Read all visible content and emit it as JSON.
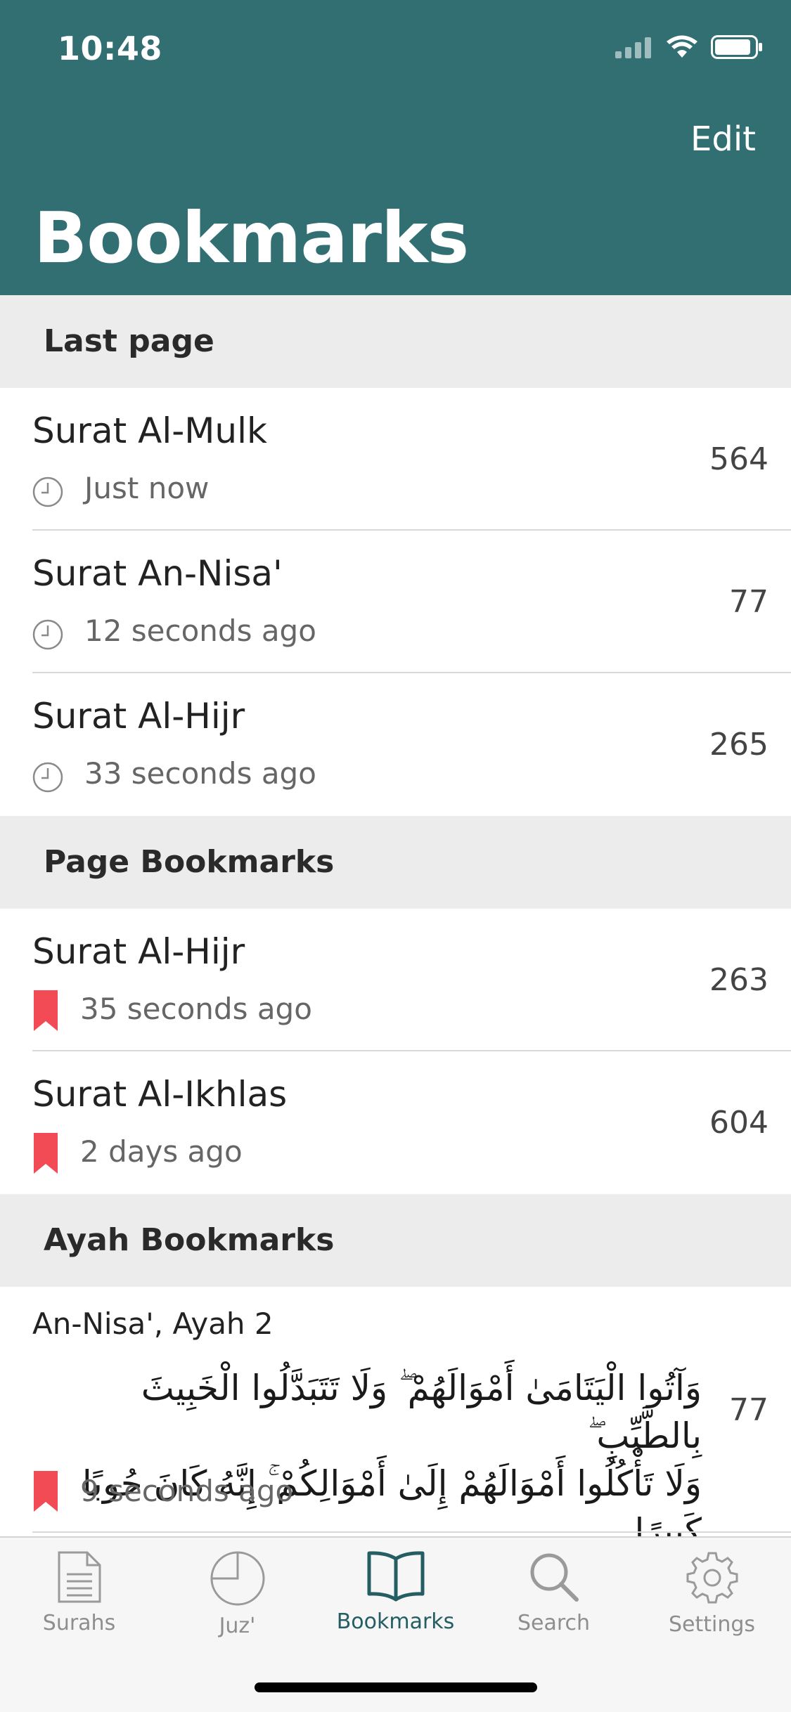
{
  "status_bar": {
    "time": "10:48"
  },
  "header": {
    "edit_label": "Edit",
    "title": "Bookmarks"
  },
  "sections": {
    "last_page": {
      "label": "Last page",
      "items": [
        {
          "title": "Surat Al-Mulk",
          "time": "Just now",
          "page": "564"
        },
        {
          "title": "Surat An-Nisa'",
          "time": "12 seconds ago",
          "page": "77"
        },
        {
          "title": "Surat Al-Hijr",
          "time": "33 seconds ago",
          "page": "265"
        }
      ]
    },
    "page_bookmarks": {
      "label": "Page Bookmarks",
      "items": [
        {
          "title": "Surat Al-Hijr",
          "time": "35 seconds ago",
          "page": "263"
        },
        {
          "title": "Surat Al-Ikhlas",
          "time": "2 days ago",
          "page": "604"
        }
      ]
    },
    "ayah_bookmarks": {
      "label": "Ayah Bookmarks",
      "items": [
        {
          "title": "An-Nisa', Ayah 2",
          "text_line1": "وَآتُوا الْيَتَامَىٰ أَمْوَالَهُمْ ۖ وَلَا تَتَبَدَّلُوا الْخَبِيثَ بِالطَّيِّبِ ۖ",
          "text_line2": "وَلَا تَأْكُلُوا أَمْوَالَهُمْ إِلَىٰ أَمْوَالِكُمْ ۚ إِنَّهُ كَانَ حُوبًا كَبِيرًا",
          "time": "9 seconds ago",
          "page": "77"
        }
      ]
    }
  },
  "tabbar": {
    "tabs": [
      {
        "label": "Surahs",
        "icon": "document-icon"
      },
      {
        "label": "Juz'",
        "icon": "pie-chart-icon"
      },
      {
        "label": "Bookmarks",
        "icon": "open-book-icon",
        "active": true
      },
      {
        "label": "Search",
        "icon": "search-icon"
      },
      {
        "label": "Settings",
        "icon": "gear-icon"
      }
    ]
  },
  "colors": {
    "header": "#316f73",
    "active_tab": "#245e63",
    "bookmark_red": "#f24b55",
    "section_bg": "#ececec"
  }
}
